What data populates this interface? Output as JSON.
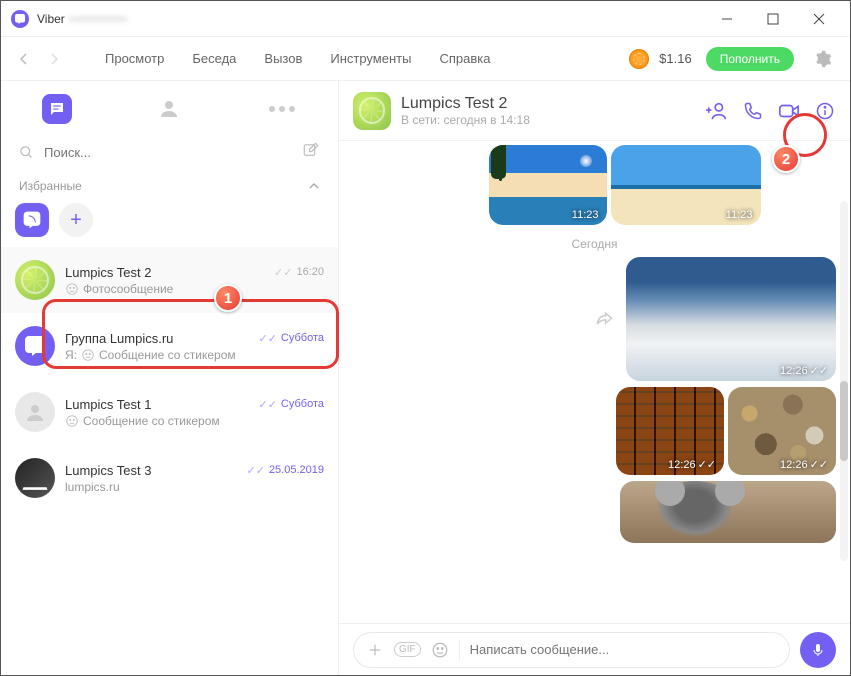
{
  "titlebar": {
    "app": "Viber",
    "phone_masked": "+••••••••••"
  },
  "menubar": {
    "items": {
      "view": "Просмотр",
      "chat": "Беседа",
      "call": "Вызов",
      "tools": "Инструменты",
      "help": "Справка"
    },
    "balance": "$1.16",
    "topup": "Пополнить"
  },
  "sidebar": {
    "search_placeholder": "Поиск...",
    "favorites_label": "Избранные"
  },
  "chats": [
    {
      "name": "Lumpics Test 2",
      "preview": "Фотосообщение",
      "time": "16:20"
    },
    {
      "name": "Группа Lumpics.ru",
      "preview_prefix": "Я:",
      "preview": "Сообщение со стикером",
      "time": "Суббота"
    },
    {
      "name": "Lumpics Test 1",
      "preview": "Сообщение со стикером",
      "time": "Суббота"
    },
    {
      "name": "Lumpics Test 3",
      "preview": "lumpics.ru",
      "time": "25.05.2019"
    }
  ],
  "convo": {
    "title": "Lumpics Test 2",
    "status": "В сети: сегодня в 14:18",
    "date_separator": "Сегодня",
    "messages": {
      "m0": {
        "time": "11:23"
      },
      "m1": {
        "time": "11:23"
      },
      "m2": {
        "time": "12:26"
      },
      "m3": {
        "time": "12:26"
      },
      "m4": {
        "time": "12:26"
      }
    }
  },
  "composer": {
    "placeholder": "Написать сообщение..."
  },
  "callouts": {
    "one": "1",
    "two": "2"
  }
}
